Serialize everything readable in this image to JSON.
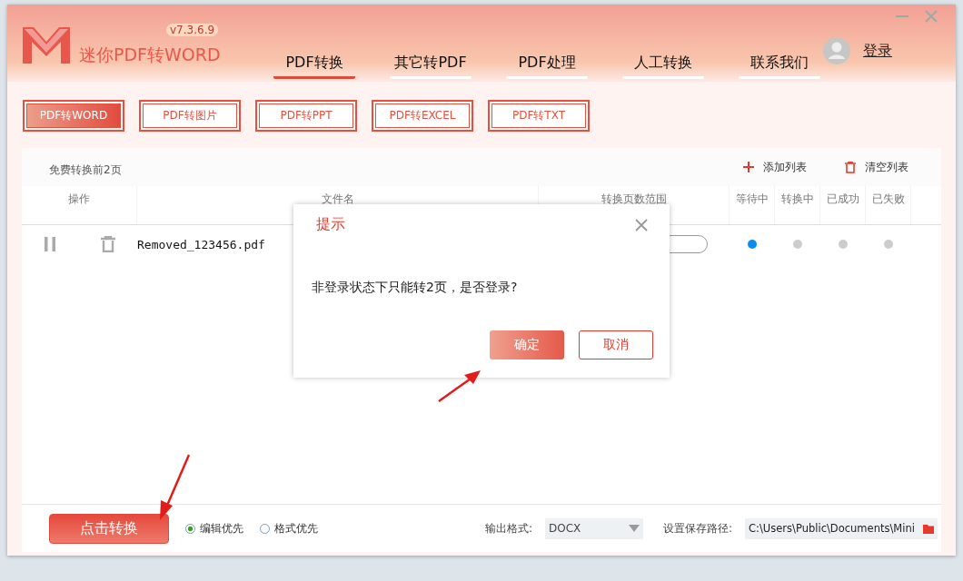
{
  "app": {
    "version": "v7.3.6.9",
    "title": "迷你PDF转WORD",
    "login": "登录"
  },
  "nav_tabs": [
    {
      "label": "PDF转换",
      "selected": true
    },
    {
      "label": "其它转PDF",
      "selected": false
    },
    {
      "label": "PDF处理",
      "selected": false
    },
    {
      "label": "人工转换",
      "selected": false
    },
    {
      "label": "联系我们",
      "selected": false
    }
  ],
  "sub_tabs": [
    {
      "label": "PDF转WORD",
      "selected": true
    },
    {
      "label": "PDF转图片",
      "selected": false
    },
    {
      "label": "PDF转PPT",
      "selected": false
    },
    {
      "label": "PDF转EXCEL",
      "selected": false
    },
    {
      "label": "PDF转TXT",
      "selected": false
    }
  ],
  "list": {
    "note": "免费转换前2页",
    "add": "添加列表",
    "clear": "清空列表",
    "columns": [
      "操作",
      "文件名",
      "转换页数范围",
      "等待中",
      "转换中",
      "已成功",
      "已失败"
    ],
    "rows": [
      {
        "file": "Removed_123456.pdf",
        "stages": [
          {
            "active": true
          },
          {
            "active": false
          },
          {
            "active": false
          },
          {
            "active": false
          }
        ]
      }
    ]
  },
  "bottom": {
    "convert": "点击转换",
    "modes": [
      {
        "label": "编辑优先",
        "selected": true
      },
      {
        "label": "格式优先",
        "selected": false
      }
    ],
    "format_label": "输出格式:",
    "format": "DOCX",
    "path_label": "设置保存路径:",
    "path": "C:\\Users\\Public\\Documents\\Mini"
  },
  "dialog": {
    "title": "提示",
    "message": "非登录状态下只能转2页，是否登录?",
    "buttons": [
      {
        "label": "确定",
        "kind": "primary"
      },
      {
        "label": "取消",
        "kind": "secondary"
      }
    ]
  }
}
